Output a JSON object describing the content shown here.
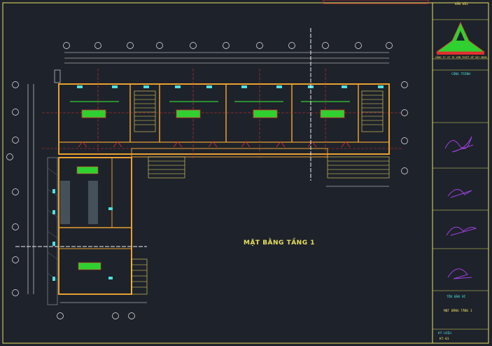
{
  "drawing": {
    "plan_title": "MẶT BẰNG TẦNG 1"
  },
  "title_block": {
    "top_label": "BẢN ĐỒI",
    "project_label": "CÔNG TRÌNH",
    "sheet_title_label": "TÊN BẢN VẼ",
    "sheet_title": "MẶT BẰNG TẦNG 1",
    "sheet_no_label": "KÝ HIỆU",
    "sheet_no": "KT-01",
    "logo_caption": "CÔNG TY CP TƯ VẤN THIẾT KẾ XÂY DỰNG"
  },
  "colors": {
    "background": "#1e222b",
    "frame": "#e8e060",
    "wall": "#e8a030",
    "grid_axis": "#e03030",
    "dimension": "#f0f0f0",
    "stair": "#f0e060",
    "furniture": "#30d030",
    "annotation": "#4ee0e0",
    "signature": "#a040e0"
  }
}
